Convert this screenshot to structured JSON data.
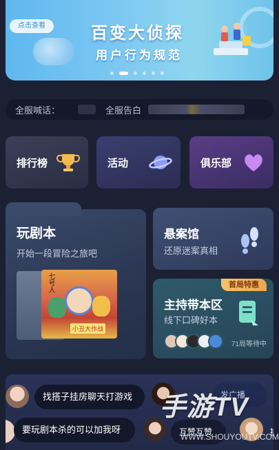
{
  "banner": {
    "button_label": "点击查看",
    "title": "百变大侦探",
    "subtitle": "用户行为规范",
    "dots": 6,
    "active_dot": 1
  },
  "announcement": {
    "label1": "全服喊话：",
    "label2": "全服告白"
  },
  "quick_links": [
    {
      "label": "排行榜",
      "icon": "trophy-icon"
    },
    {
      "label": "活动",
      "icon": "planet-icon"
    },
    {
      "label": "俱乐部",
      "icon": "heart-icon"
    }
  ],
  "play_script": {
    "title": "玩剧本",
    "subtitle": "开始一段冒险之旅吧",
    "poster_caption": "小丑大作战",
    "poster_vertical": "七号人"
  },
  "mystery_hall": {
    "title": "悬案馆",
    "subtitle": "还原迷案真相",
    "icon": "footprint-icon"
  },
  "host_room": {
    "badge": "首局特惠",
    "title": "主持带本区",
    "subtitle": "线下口碑好本",
    "wait_text": "71局等待中",
    "icon": "script-book-icon"
  },
  "chat": {
    "bubble1": "找搭子挂房聊天打游戏",
    "bubble2": "要玩剧本杀的可以加我呀",
    "bubble3": "互赞互赞",
    "bubble4": "发广播",
    "extra": "换"
  },
  "watermark": {
    "text": "手游TV",
    "url": "WWW.SHOUYOUTV.COM"
  },
  "colors": {
    "background": "#1c2033",
    "badge": "#f0a64a",
    "banner": "#7fc9f2"
  }
}
